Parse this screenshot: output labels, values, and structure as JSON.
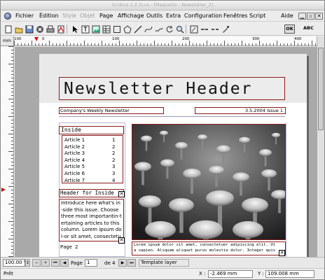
{
  "window": {
    "title": "Scribus 1.2.2cvs - [Maquette : Newsletter_2]"
  },
  "menu": {
    "items": [
      {
        "label": "Fichier",
        "enabled": true
      },
      {
        "label": "Édition",
        "enabled": true
      },
      {
        "label": "Style",
        "enabled": false
      },
      {
        "label": "Objet",
        "enabled": false
      },
      {
        "label": "Page",
        "enabled": true
      },
      {
        "label": "Affichage",
        "enabled": true
      },
      {
        "label": "Outils",
        "enabled": true
      },
      {
        "label": "Extra",
        "enabled": true
      },
      {
        "label": "Configuration",
        "enabled": true
      },
      {
        "label": "Fenêtres",
        "enabled": true
      },
      {
        "label": "Script",
        "enabled": true
      }
    ],
    "help": "Aide"
  },
  "toolbar": {
    "icons": [
      "new-document-icon",
      "open-folder-icon",
      "save-icon",
      "close-document-icon",
      "print-icon",
      "pdf-export-icon",
      "select-arrow-icon",
      "text-frame-icon",
      "image-frame-icon",
      "table-icon",
      "shape-icon",
      "polygon-icon",
      "line-icon",
      "bezier-icon",
      "freehand-icon",
      "rotate-icon",
      "zoom-icon",
      "edit-contents-icon",
      "link-frames-icon",
      "unlink-frames-icon",
      "eyedropper-icon"
    ],
    "ok_label": "OK",
    "abc_label": "ABC"
  },
  "ruler": {
    "unit": "mm",
    "labels": [
      "100",
      "0",
      "100",
      "200",
      "300",
      "400"
    ]
  },
  "document": {
    "header_title": "Newsletter Header",
    "company": "Company's Weekly Newsletter",
    "date_issue": "3.5.2004 Issue 1",
    "inside_title": "Inside",
    "toc": [
      {
        "label": "Article 1",
        "page": "1"
      },
      {
        "label": "Article 2",
        "page": "2"
      },
      {
        "label": "Article 3",
        "page": "2"
      },
      {
        "label": "Article 4",
        "page": "2"
      },
      {
        "label": "Article 5",
        "page": "3"
      },
      {
        "label": "Article 6",
        "page": "3"
      },
      {
        "label": "Article 7",
        "page": "4"
      }
    ],
    "header_for_inside": "Header for Inside",
    "intro_text": "Introduce here what's in-side this issue. Choose three most importantin-tertaining articles to this column. Lorem ipsum dol-or sit amet, consectetuer adipiscing elit. Ut a sap",
    "page_label": "Page 2",
    "caption_line1": "Lorem ipsum dolor sit amet, consectetuer adipiscing elit. Ut",
    "caption_line2": "a sapien. Aliquam aliquet purus molestie dolor. Integer quis"
  },
  "bottom": {
    "zoom": "100.00 %",
    "page_prefix": "Page",
    "page_number": "1",
    "page_of": "de 4",
    "layer": "Template layer"
  },
  "status": {
    "text": "Prêt",
    "x_label": "X :",
    "x_value": "-2.469 mm",
    "y_label": "Y :",
    "y_value": "109.008 mm"
  }
}
